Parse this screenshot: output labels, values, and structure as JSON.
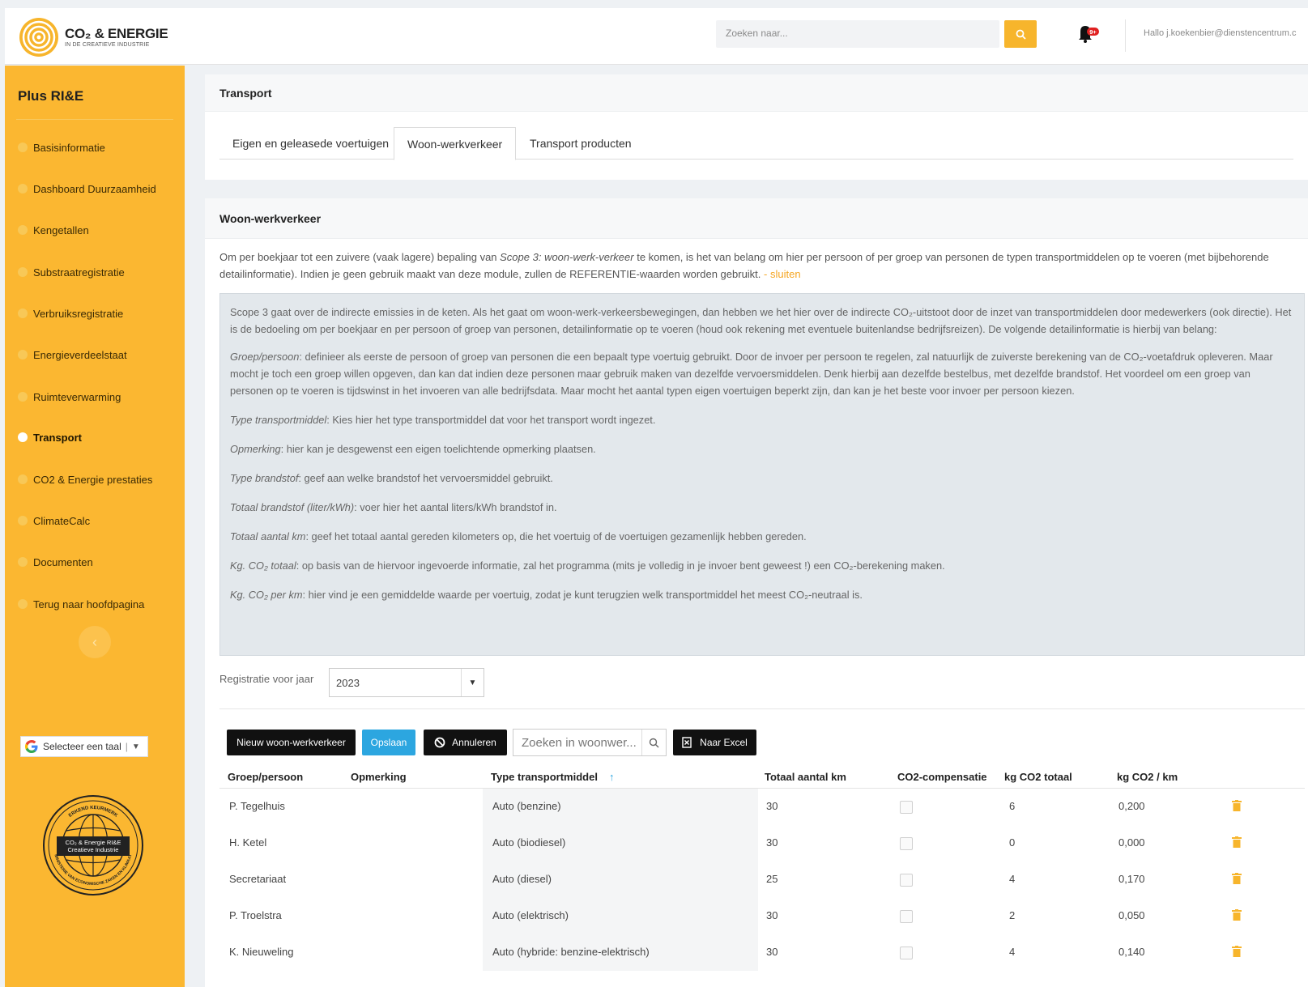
{
  "header": {
    "logo_text": "CO₂ & ENERGIE",
    "logo_sub": "IN DE CREATIEVE INDUSTRIE",
    "search_placeholder": "Zoeken naar...",
    "notification_badge": "9+",
    "greeting": "Hallo j.koekenbier@dienstencentrum.c"
  },
  "sidebar": {
    "title": "Plus RI&E",
    "items": [
      {
        "label": "Basisinformatie"
      },
      {
        "label": "Dashboard Duurzaamheid"
      },
      {
        "label": "Kengetallen"
      },
      {
        "label": "Substraatregistratie"
      },
      {
        "label": "Verbruiksregistratie"
      },
      {
        "label": "Energieverdeelstaat"
      },
      {
        "label": "Ruimteverwarming"
      },
      {
        "label": "Transport"
      },
      {
        "label": "CO2 & Energie prestaties"
      },
      {
        "label": "ClimateCalc"
      },
      {
        "label": "Documenten"
      },
      {
        "label": "Terug naar hoofdpagina"
      }
    ],
    "active_item": "Transport",
    "collapse_label": "‹",
    "language_label": "Selecteer een taal",
    "language_sep": "|",
    "language_caret": "▼",
    "seal_top": "ERKEND KEURMERK",
    "seal_center1": "CO₂ & Energie RI&E",
    "seal_center2": "Creatieve Industrie",
    "seal_bottom": "MINISTERIE VAN ECONOMISCHE ZAKEN EN KLIMAAT"
  },
  "transport_panel": {
    "title": "Transport",
    "tabs": [
      {
        "label": "Eigen en geleasede voertuigen"
      },
      {
        "label": "Woon-werkverkeer"
      },
      {
        "label": "Transport producten"
      }
    ],
    "active_tab": "Woon-werkverkeer"
  },
  "woon_panel": {
    "title": "Woon-werkverkeer",
    "intro_a": "Om per boekjaar tot een zuivere (vaak lagere) bepaling van ",
    "intro_em": "Scope 3: woon-werk-verkeer",
    "intro_b": " te komen, is het van belang om hier per persoon of per groep van personen de typen transportmiddelen op te voeren (met bijbehorende detailinformatie). Indien je geen gebruik maakt van deze module, zullen de REFERENTIE-waarden worden gebruikt.",
    "intro_link": " - sluiten",
    "info": {
      "p1": "Scope 3 gaat over de indirecte emissies in de keten. Als het gaat om woon-werk-verkeersbewegingen, dan hebben we het hier over de indirecte CO₂-uitstoot door de inzet van transportmiddelen door medewerkers (ook directie). Het is de bedoeling om per boekjaar en per persoon of groep van personen, detailinformatie op te voeren (houd ook rekening met eventuele buitenlandse bedrijfsreizen). De volgende detailinformatie is hierbij van belang:",
      "p2_em": "Groep/persoon",
      "p2": ": definieer als eerste de persoon of groep van personen die een bepaalt type voertuig gebruikt. Door de invoer per persoon te regelen, zal natuurlijk de zuiverste berekening van de CO₂-voetafdruk opleveren. Maar mocht je toch een groep willen opgeven, dan kan dat indien deze personen maar gebruik maken van dezelfde vervoersmiddelen. Denk hierbij aan dezelfde bestelbus, met dezelfde brandstof. Het voordeel om een groep van personen op te voeren is tijdswinst in het invoeren van alle bedrijfsdata. Maar mocht het aantal typen eigen voertuigen beperkt zijn, dan kan je het beste voor invoer per persoon kiezen.",
      "p3_em": "Type transportmiddel",
      "p3": ": Kies hier het type transportmiddel dat voor het transport wordt ingezet.",
      "p4_em": "Opmerking",
      "p4": ": hier kan je desgewenst een eigen toelichtende opmerking plaatsen.",
      "p5_em": "Type brandstof",
      "p5": ": geef aan welke brandstof het vervoersmiddel gebruikt.",
      "p6_em": "Totaal brandstof (liter/kWh)",
      "p6": ": voer hier het aantal liters/kWh brandstof in.",
      "p7_em": "Totaal aantal km",
      "p7": ": geef het totaal aantal gereden kilometers op, die het voertuig of de voertuigen gezamenlijk hebben gereden.",
      "p8_em": "Kg. CO₂ totaal",
      "p8": ": op basis van de hiervoor ingevoerde informatie, zal het programma (mits je volledig in je invoer bent geweest !) een CO₂-berekening maken.",
      "p9_em": "Kg. CO₂ per km",
      "p9": ": hier vind je een gemiddelde waarde per voertuig, zodat je kunt terugzien welk transportmiddel het meest CO₂-neutraal is."
    },
    "year_label": "Registratie voor jaar",
    "year_value": "2023",
    "year_caret": "▼",
    "buttons": {
      "new": "Nieuw woon-werkverkeer",
      "save": "Opslaan",
      "cancel": "Annuleren",
      "excel": "Naar Excel"
    },
    "grid_search_placeholder": "Zoeken in woonwer...",
    "columns": [
      "Groep/persoon",
      "Opmerking",
      "Type transportmiddel",
      "Totaal aantal km",
      "CO2-compensatie",
      "kg CO2 totaal",
      "kg CO2 / km"
    ],
    "sort_indicator": "↑",
    "rows": [
      {
        "groep": "P. Tegelhuis",
        "opmerking": "",
        "type": "Auto (benzine)",
        "km": "30",
        "totaal": "6",
        "perkm": "0,200"
      },
      {
        "groep": "H. Ketel",
        "opmerking": "",
        "type": "Auto (biodiesel)",
        "km": "30",
        "totaal": "0",
        "perkm": "0,000"
      },
      {
        "groep": "Secretariaat",
        "opmerking": "",
        "type": "Auto (diesel)",
        "km": "25",
        "totaal": "4",
        "perkm": "0,170"
      },
      {
        "groep": "P. Troelstra",
        "opmerking": "",
        "type": "Auto (elektrisch)",
        "km": "30",
        "totaal": "2",
        "perkm": "0,050"
      },
      {
        "groep": "K. Nieuweling",
        "opmerking": "",
        "type": "Auto (hybride: benzine-elektrisch)",
        "km": "30",
        "totaal": "4",
        "perkm": "0,140"
      }
    ]
  },
  "colors": {
    "accent": "#fbb731",
    "search_button": "#f7b52c",
    "save_button": "#2ca6e0",
    "link": "#f5a623"
  }
}
